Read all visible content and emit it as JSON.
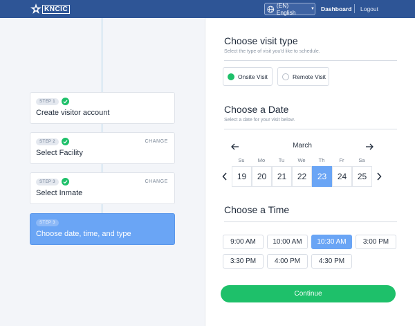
{
  "header": {
    "logo_text": "KNCIC",
    "language": "(EN) English",
    "dashboard": "Dashboard",
    "logout": "Logout"
  },
  "steps": [
    {
      "badge": "STEP 1",
      "title": "Create visitor account",
      "complete": true,
      "change": ""
    },
    {
      "badge": "STEP 2",
      "title": "Select Facility",
      "complete": true,
      "change": "CHANGE"
    },
    {
      "badge": "STEP 3",
      "title": "Select Inmate",
      "complete": true,
      "change": "CHANGE"
    },
    {
      "badge": "STEP 3",
      "title": "Choose date, time, and type",
      "complete": false,
      "change": ""
    }
  ],
  "visit_type": {
    "title": "Choose visit type",
    "subtitle": "Select the type of visit you'd like to schedule.",
    "options": [
      {
        "label": "Onsite Visit",
        "selected": true
      },
      {
        "label": "Remote Visit",
        "selected": false
      }
    ]
  },
  "date": {
    "title": "Choose a Date",
    "subtitle": "Select a date for your visit below.",
    "month": "March",
    "weekdays": [
      "Su",
      "Mo",
      "Tu",
      "We",
      "Th",
      "Fr",
      "Sa"
    ],
    "days": [
      "19",
      "20",
      "21",
      "22",
      "23",
      "24",
      "25"
    ],
    "selected_day": "23"
  },
  "time": {
    "title": "Choose a Time",
    "slots": [
      "9:00 AM",
      "10:00 AM",
      "10:30 AM",
      "3:00 PM",
      "3:30 PM",
      "4:00 PM",
      "4:30 PM"
    ],
    "selected": "10:30 AM"
  },
  "continue_label": "Continue",
  "colors": {
    "header_bg": "#2e5596",
    "accent_blue": "#6aa5f5",
    "success_green": "#1ec06a"
  },
  "icons": {
    "logo": "star-logo-icon",
    "language": "globe-icon",
    "step_done": "check-circle-icon",
    "prev_month": "arrow-left-icon",
    "next_month": "arrow-right-icon",
    "prev_week": "chevron-left-icon",
    "next_week": "chevron-right-icon"
  }
}
